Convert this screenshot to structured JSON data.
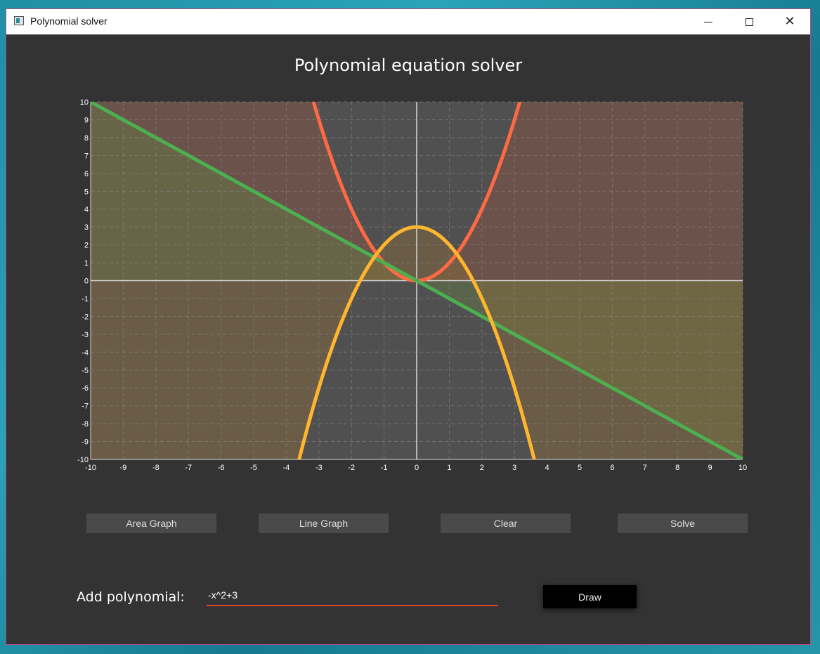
{
  "window": {
    "title": "Polynomial solver"
  },
  "page": {
    "heading": "Polynomial equation solver"
  },
  "buttons": {
    "area_graph": "Area Graph",
    "line_graph": "Line Graph",
    "clear": "Clear",
    "solve": "Solve",
    "draw": "Draw"
  },
  "input": {
    "label": "Add polynomial:",
    "value": "-x^2+3"
  },
  "icons": {
    "app": "app-window-icon",
    "minimize": "minimize-icon",
    "maximize": "maximize-icon",
    "close": "close-icon"
  },
  "chart_data": {
    "type": "line",
    "xlim": [
      -10,
      10
    ],
    "ylim": [
      -10,
      10
    ],
    "xticks": [
      -10,
      -9,
      -8,
      -7,
      -6,
      -5,
      -4,
      -3,
      -2,
      -1,
      0,
      1,
      2,
      3,
      4,
      5,
      6,
      7,
      8,
      9,
      10
    ],
    "yticks": [
      -10,
      -9,
      -8,
      -7,
      -6,
      -5,
      -4,
      -3,
      -2,
      -1,
      0,
      1,
      2,
      3,
      4,
      5,
      6,
      7,
      8,
      9,
      10
    ],
    "grid": true,
    "series": [
      {
        "expr": "x^2",
        "color": "#ff6a45",
        "fill": "#8c5545"
      },
      {
        "expr": "-x",
        "color": "#4caf50",
        "fill": "#657a45"
      },
      {
        "expr": "-x^2+3",
        "color": "#ffb52e",
        "fill": "#8a6a3a"
      }
    ]
  }
}
